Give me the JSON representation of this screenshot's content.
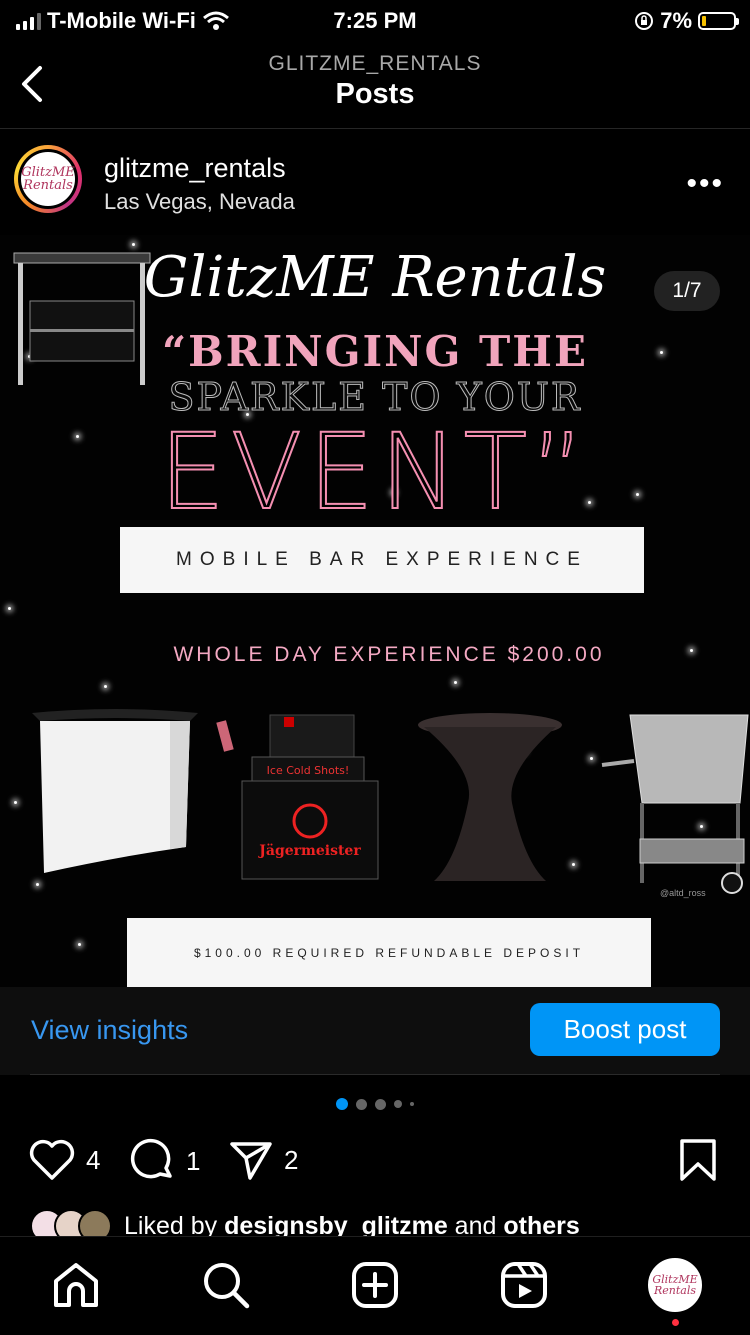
{
  "status": {
    "carrier": "T-Mobile Wi-Fi",
    "time": "7:25 PM",
    "battery": "7%"
  },
  "nav": {
    "subtitle": "GLITZME_RENTALS",
    "title": "Posts"
  },
  "post_header": {
    "username": "glitzme_rentals",
    "location": "Las Vegas, Nevada",
    "avatar_text": "GlitzME Rentals"
  },
  "post_image": {
    "brand": "GlitzME Rentals",
    "line1": "“BRINGING THE",
    "line2": "SPARKLE TO YOUR",
    "line3": "EVENT”",
    "service": "MOBILE BAR EXPERIENCE",
    "price": "WHOLE DAY EXPERIENCE $200.00",
    "deposit": "$100.00 REQUIRED REFUNDABLE DEPOSIT",
    "counter": "1/7",
    "watermark": "@altd_ross",
    "products": [
      "bar table",
      "mobile bar",
      "Jägermeister cooler",
      "cocktail table",
      "ice tub cart"
    ]
  },
  "insights": {
    "view": "View insights",
    "boost": "Boost post"
  },
  "carousel": {
    "total_dots": 5,
    "active_index": 0
  },
  "actions": {
    "likes": "4",
    "comments": "1",
    "shares": "2"
  },
  "liked_by": {
    "prefix": "Liked by ",
    "user": "designsby_glitzme",
    "middle": " and ",
    "others": "others"
  },
  "tabs": [
    "home-icon",
    "search-icon",
    "create-icon",
    "reels-icon",
    "profile-avatar"
  ],
  "colors": {
    "link_blue": "#3897f0",
    "boost_blue": "#0095f6",
    "pink": "#f4a9c3"
  }
}
